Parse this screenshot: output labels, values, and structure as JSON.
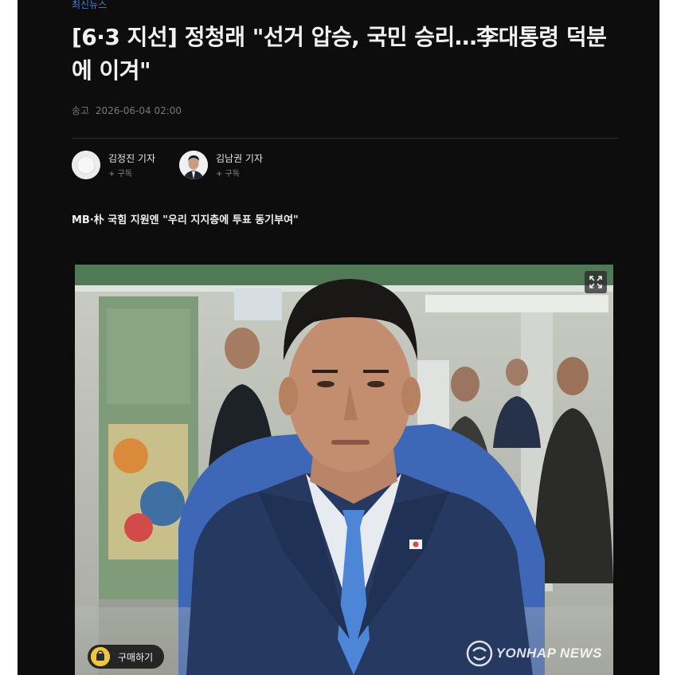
{
  "category": "최신뉴스",
  "headline": "[6·3 지선] 정청래 \"선거 압승, 국민 승리…李대통령 덕분에 이겨\"",
  "dateline": {
    "label": "송고",
    "datetime": "2026-06-04 02:00"
  },
  "reporters": [
    {
      "name": "김정진 기자",
      "subscribe": "+ 구독"
    },
    {
      "name": "김남권 기자",
      "subscribe": "+ 구독"
    }
  ],
  "subheadline": "MB·朴 국힘 지원엔 \"우리 지지층에 투표 동기부여\"",
  "photo": {
    "buy_label": "구매하기",
    "watermark": "YONHAP NEWS"
  },
  "colors": {
    "background": "#0d0d0d",
    "category": "#4a7fd6",
    "buy_coin": "#f2c63b"
  }
}
